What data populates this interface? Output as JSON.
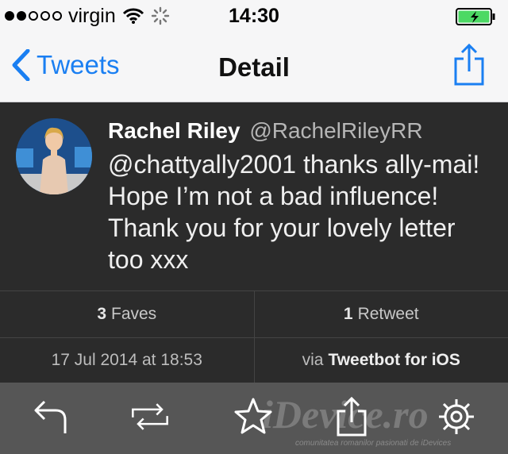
{
  "status_bar": {
    "carrier": "virgin",
    "time": "14:30"
  },
  "nav": {
    "back_label": "Tweets",
    "title": "Detail"
  },
  "tweet": {
    "name": "Rachel Riley",
    "handle": "@RachelRileyRR",
    "text": "@chattyally2001 thanks ally-mai! Hope I’m not a bad influence! Thank you for your lovely letter too xxx"
  },
  "stats": {
    "faves_count": "3",
    "faves_label": "Faves",
    "retweets_count": "1",
    "retweets_label": "Retweet"
  },
  "meta": {
    "timestamp": "17 Jul 2014 at 18:53",
    "via_prefix": "via",
    "via_client": "Tweetbot for iOS"
  },
  "toolbar": {
    "items": [
      "reply-icon",
      "retweet-icon",
      "favorite-star-icon",
      "share-icon",
      "settings-gear-icon"
    ]
  },
  "watermark": {
    "brand": "iDevice.ro",
    "tagline": "comunitatea romanilor pasionati de iDevices"
  },
  "colors": {
    "accent": "#1a7ff2",
    "battery": "#4cd964",
    "tweet_bg": "#2b2b2b",
    "toolbar_bg": "#565656"
  }
}
